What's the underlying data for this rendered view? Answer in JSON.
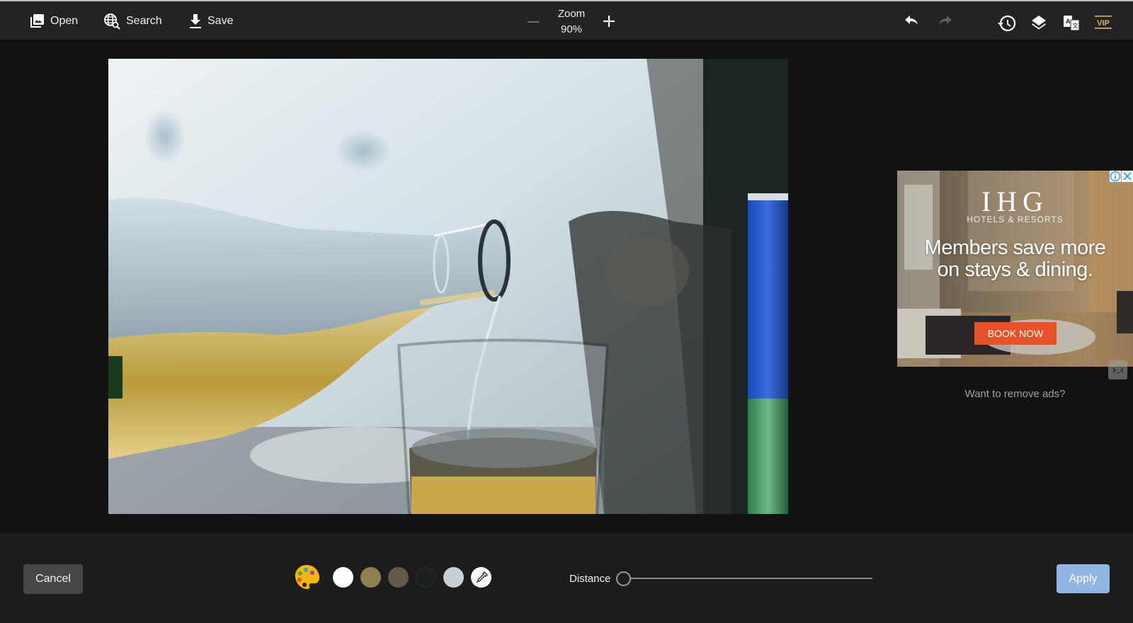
{
  "toolbar": {
    "open_label": "Open",
    "search_label": "Search",
    "save_label": "Save",
    "zoom_label": "Zoom",
    "zoom_value": "90%",
    "vip_label": "VIP",
    "icons": {
      "open": "image-gallery-icon",
      "search": "globe-search-icon",
      "save": "download-icon",
      "zoom_out": "minus-icon",
      "zoom_in": "plus-icon",
      "undo": "undo-icon",
      "redo": "redo-icon",
      "history": "history-icon",
      "layers": "layers-icon",
      "translate": "translate-icon",
      "vip": "vip-badge-icon"
    },
    "redo_enabled": false,
    "zoom_out_enabled": false
  },
  "canvas": {
    "image_description": "Photo of a clear bottle pouring sparkling liquid into a glass, blurred background with a blue-green can on the right"
  },
  "ad": {
    "brand": "IHG",
    "brand_sub": "HOTELS & RESORTS",
    "headline": "Members save more on stays & dining.",
    "cta": "BOOK NOW",
    "cta_color": "#e8522a",
    "remove_ads_text": "Want to remove ads?"
  },
  "bottom": {
    "cancel_label": "Cancel",
    "apply_label": "Apply",
    "apply_color": "#8fb6e3",
    "palette_icon": "color-palette-icon",
    "swatches": [
      {
        "name": "white",
        "color": "#ffffff"
      },
      {
        "name": "khaki",
        "color": "#8f8054"
      },
      {
        "name": "taupe",
        "color": "#625949"
      },
      {
        "name": "dark-green",
        "color": "#1b211c"
      },
      {
        "name": "light-gray",
        "color": "#c7ced4"
      }
    ],
    "eyedropper_icon": "eyedropper-icon",
    "distance_label": "Distance",
    "distance_value": 0
  }
}
